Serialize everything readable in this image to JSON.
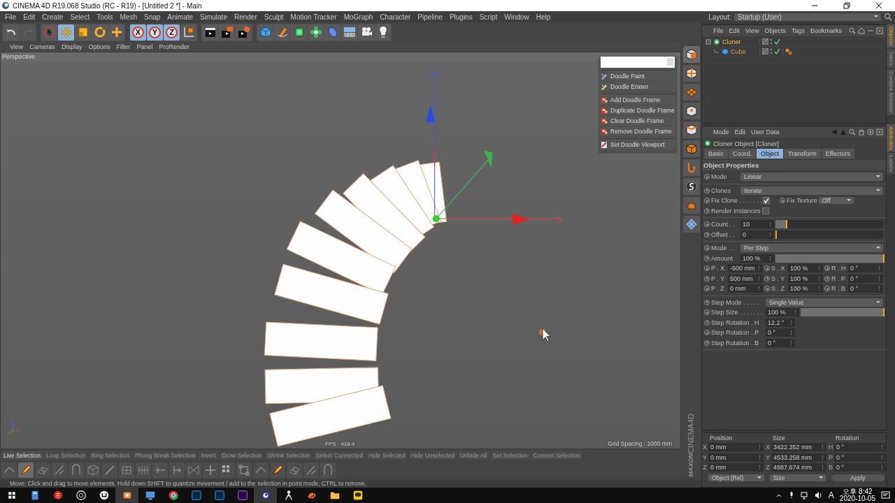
{
  "window": {
    "title": "CINEMA 4D R19.068 Studio (RC - R19) - [Untitled 2 *] - Main"
  },
  "menu_bar": [
    "File",
    "Edit",
    "Create",
    "Select",
    "Tools",
    "Mesh",
    "Snap",
    "Animate",
    "Simulate",
    "Render",
    "Sculpt",
    "Motion Tracker",
    "MoGraph",
    "Character",
    "Pipeline",
    "Plugins",
    "Script",
    "Window",
    "Help"
  ],
  "layout": {
    "label": "Layout:",
    "value": "Startup (User)"
  },
  "main_toolbar": [
    {
      "selected": false,
      "disabled": false
    },
    {
      "selected": false,
      "disabled": true
    },
    {
      "selected": false,
      "disabled": false
    },
    {
      "selected": true,
      "disabled": false
    },
    {
      "selected": false,
      "disabled": false
    },
    {
      "selected": false,
      "disabled": false
    },
    {
      "selected": false,
      "disabled": false
    },
    {
      "label": "X",
      "selected": true,
      "disabled": false
    },
    {
      "label": "Y",
      "selected": true,
      "disabled": false
    },
    {
      "label": "Z",
      "selected": true,
      "disabled": false
    },
    {
      "selected": false,
      "disabled": false
    },
    {
      "selected": false,
      "disabled": false
    },
    {
      "selected": false,
      "disabled": false
    },
    {
      "selected": false,
      "disabled": false
    },
    {
      "selected": false,
      "disabled": false
    },
    {
      "selected": false,
      "disabled": false
    },
    {
      "selected": false,
      "disabled": false
    },
    {
      "selected": false,
      "disabled": false
    },
    {
      "selected": false,
      "disabled": false
    },
    {
      "selected": false,
      "disabled": false
    },
    {
      "selected": false,
      "disabled": false
    },
    {
      "selected": false,
      "disabled": false
    }
  ],
  "viewport": {
    "menu": [
      "View",
      "Cameras",
      "Display",
      "Options",
      "Filter",
      "Panel",
      "ProRender"
    ],
    "camera": "Perspective",
    "fps": "FPS : 418.4",
    "grid_spacing": "Grid Spacing : 1000 mm"
  },
  "doodle_menu": [
    [
      "Doodle Paint",
      "Doodle Eraser"
    ],
    [
      "Add Doodle Frame",
      "Duplicate Doodle Frame",
      "Clear Doodle Frame",
      "Remove Doodle Frame"
    ],
    [
      "Set Doodle Viewport"
    ]
  ],
  "selection_bar": [
    {
      "label": "Live Selection",
      "disabled": false
    },
    {
      "label": "Loop Selection",
      "disabled": true
    },
    {
      "label": "Ring Selection",
      "disabled": true
    },
    {
      "label": "Phong Break Selection",
      "disabled": true
    },
    {
      "label": "Invert",
      "disabled": true
    },
    {
      "label": "Grow Selection",
      "disabled": true
    },
    {
      "label": "Shrink Selection",
      "disabled": true
    },
    {
      "label": "Select Connected",
      "disabled": true
    },
    {
      "label": "Hide Selected",
      "disabled": true
    },
    {
      "label": "Hide Unselected",
      "disabled": true
    },
    {
      "label": "Unhide All",
      "disabled": true
    },
    {
      "label": "Set Selection",
      "disabled": true
    },
    {
      "label": "Convert Selection",
      "disabled": true
    }
  ],
  "mesh_tools": [
    {
      "selected": false
    },
    {
      "selected": true
    },
    {
      "selected": false
    },
    {
      "selected": false
    },
    {
      "selected": false
    },
    {
      "selected": false
    },
    {
      "selected": false
    },
    {
      "selected": false
    },
    {
      "selected": false
    },
    {
      "selected": false
    },
    {
      "selected": false
    },
    {
      "selected": false
    },
    {
      "selected": false
    },
    {
      "selected": false
    },
    {
      "selected": false
    },
    {
      "selected": false
    },
    {
      "selected": false
    },
    {
      "selected": false
    },
    {
      "selected": false
    },
    {
      "selected": false
    }
  ],
  "status_bar": "Move: Click and drag to move elements. Hold down SHIFT to quantize movement / add to the selection in point mode, CTRL to remove.",
  "brand": [
    "MAXON",
    "CINEMA4D"
  ],
  "object_manager": {
    "menu": [
      "File",
      "Edit",
      "View",
      "Objects",
      "Tags",
      "Bookmarks"
    ],
    "objects": [
      {
        "name": "Cloner",
        "selected": true,
        "expanded": true,
        "children": [
          {
            "name": "Cube",
            "selected": false
          }
        ]
      }
    ]
  },
  "attributes": {
    "menu": [
      "Mode",
      "Edit",
      "User Data"
    ],
    "title": "Cloner Object [Cloner]",
    "tabs": [
      {
        "label": "Basic",
        "selected": false
      },
      {
        "label": "Coord.",
        "selected": false
      },
      {
        "label": "Object",
        "selected": true
      },
      {
        "label": "Transform",
        "selected": false
      },
      {
        "label": "Effectors",
        "selected": false
      }
    ],
    "section": "Object Properties",
    "groups": [
      [
        {
          "kind": "dropdown",
          "label": "Mode",
          "value": "Linear"
        }
      ],
      [
        {
          "kind": "dropdown",
          "label": "Clones",
          "value": "Iterate"
        },
        {
          "kind": "check_dropdown",
          "label": "Fix Clone . . . . . . .",
          "checked": true,
          "label2": "Fix Texture",
          "value2": "Off"
        },
        {
          "kind": "check",
          "label": "Render Instances",
          "checked": false
        }
      ],
      [
        {
          "kind": "slider",
          "label": "Count . .",
          "value": "10",
          "level": 0.1
        },
        {
          "kind": "slider",
          "label": "Offset . .",
          "value": "0",
          "level": 0
        }
      ],
      [
        {
          "kind": "dropdown",
          "label": "Mode . .",
          "value": "Per Step"
        },
        {
          "kind": "slider",
          "label": "Amount",
          "value": "100 %",
          "level": 1
        },
        {
          "kind": "vector",
          "cells": [
            {
              "label": "P . X",
              "value": "-500 mm"
            },
            {
              "label": "S . X",
              "value": "100 %"
            },
            {
              "label": "R . H",
              "value": "0 °"
            }
          ]
        },
        {
          "kind": "vector",
          "cells": [
            {
              "label": "P . Y",
              "value": "500 mm"
            },
            {
              "label": "S . Y",
              "value": "100 %"
            },
            {
              "label": "R . P",
              "value": "0 °"
            }
          ]
        },
        {
          "kind": "vector",
          "cells": [
            {
              "label": "P . Z",
              "value": "0 mm"
            },
            {
              "label": "S . Z",
              "value": "100 %"
            },
            {
              "label": "R . B",
              "value": "0 °"
            }
          ]
        }
      ],
      [
        {
          "kind": "dropdown",
          "label": "Step Mode . . . . .",
          "value": "Single Value"
        },
        {
          "kind": "slider",
          "label": "Step Size . . . . . . .",
          "value": "100 %",
          "level": 1
        },
        {
          "kind": "number",
          "label": "Step Rotation . H",
          "value": "12.2 °"
        },
        {
          "kind": "number",
          "label": "Step Rotation . P",
          "value": "0 °"
        },
        {
          "kind": "number",
          "label": "Step Rotation . B",
          "value": "0 °"
        }
      ]
    ]
  },
  "coordinates": {
    "headers": [
      "Position",
      "Size",
      "Rotation"
    ],
    "rows": [
      [
        {
          "axis": "X",
          "value": "0 mm"
        },
        {
          "axis": "X",
          "value": "3422.352 mm"
        },
        {
          "axis": "H",
          "value": "0 °"
        }
      ],
      [
        {
          "axis": "Y",
          "value": "0 mm"
        },
        {
          "axis": "Y",
          "value": "4533.258 mm"
        },
        {
          "axis": "P",
          "value": "0 °"
        }
      ],
      [
        {
          "axis": "Z",
          "value": "0 mm"
        },
        {
          "axis": "Z",
          "value": "4987.674 mm"
        },
        {
          "axis": "B",
          "value": "0 °"
        }
      ]
    ],
    "dropdowns": [
      "Object (Rel)",
      "Size"
    ],
    "apply": "Apply"
  },
  "side_tabs": [
    [
      {
        "label": "Objects",
        "selected": true
      },
      {
        "label": "Takes",
        "selected": false
      },
      {
        "label": "Content Browser",
        "selected": false
      }
    ],
    [
      {
        "label": "Attributes",
        "selected": true
      },
      {
        "label": "Layers",
        "selected": false
      }
    ]
  ],
  "taskbar": {
    "apps": [
      {
        "selected": false
      },
      {
        "selected": false
      },
      {
        "selected": false
      },
      {
        "selected": false
      },
      {
        "selected": true
      },
      {
        "selected": false
      },
      {
        "selected": false
      },
      {
        "selected": false
      },
      {
        "selected": false
      },
      {
        "selected": false
      },
      {
        "selected": true
      },
      {
        "selected": false
      },
      {
        "selected": false
      },
      {
        "selected": false
      },
      {
        "selected": false
      }
    ],
    "input_indicator": "A",
    "time": "오후 8:42",
    "date": "2020-10-05"
  }
}
